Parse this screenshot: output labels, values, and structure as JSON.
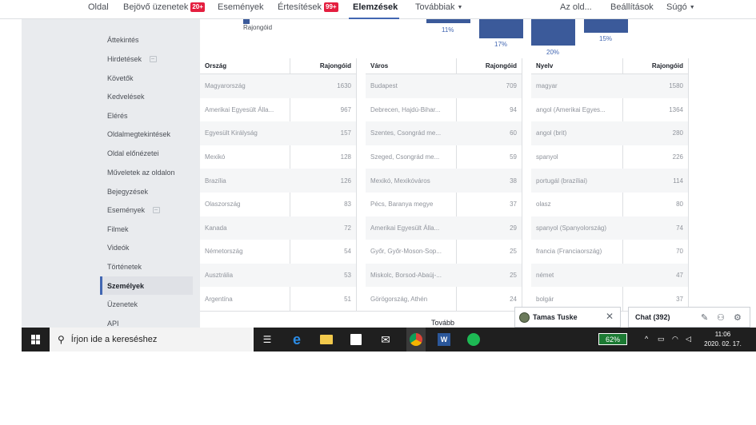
{
  "topnav": {
    "items": [
      {
        "label": "Oldal"
      },
      {
        "label": "Bejövő üzenetek",
        "badge": "20+"
      },
      {
        "label": "Események"
      },
      {
        "label": "Értesítések",
        "badge": "99+"
      },
      {
        "label": "Elemzések"
      },
      {
        "label": "Továbbiak"
      }
    ],
    "right": [
      "Az old...",
      "Beállítások",
      "Súgó"
    ]
  },
  "chart_remnant": {
    "legend_label": "Rajongóid",
    "bars": [
      {
        "label": "11%",
        "value": 11
      },
      {
        "label": "17%",
        "value": 17
      },
      {
        "label": "20%",
        "value": 20
      },
      {
        "label": "15%",
        "value": 15
      }
    ]
  },
  "sidebar": {
    "items": [
      {
        "label": "Áttekintés"
      },
      {
        "label": "Hirdetések"
      },
      {
        "label": "Követők"
      },
      {
        "label": "Kedvelések"
      },
      {
        "label": "Elérés"
      },
      {
        "label": "Oldalmegtekintések"
      },
      {
        "label": "Oldal előnézetei"
      },
      {
        "label": "Műveletek az oldalon"
      },
      {
        "label": "Bejegyzések"
      },
      {
        "label": "Események"
      },
      {
        "label": "Filmek"
      },
      {
        "label": "Videók"
      },
      {
        "label": "Történetek"
      },
      {
        "label": "Személyek"
      },
      {
        "label": "Üzenetek"
      },
      {
        "label": "API"
      }
    ]
  },
  "tables": [
    {
      "col1": "Ország",
      "col2": "Rajongóid",
      "rows": [
        [
          "Magyarország",
          "1630"
        ],
        [
          "Amerikai Egyesült Álla...",
          "967"
        ],
        [
          "Egyesült Királyság",
          "157"
        ],
        [
          "Mexikó",
          "128"
        ],
        [
          "Brazília",
          "126"
        ],
        [
          "Olaszország",
          "83"
        ],
        [
          "Kanada",
          "72"
        ],
        [
          "Németország",
          "54"
        ],
        [
          "Ausztrália",
          "53"
        ],
        [
          "Argentína",
          "51"
        ]
      ]
    },
    {
      "col1": "Város",
      "col2": "Rajongóid",
      "rows": [
        [
          "Budapest",
          "709"
        ],
        [
          "Debrecen, Hajdú-Bihar...",
          "94"
        ],
        [
          "Szentes, Csongrád me...",
          "60"
        ],
        [
          "Szeged, Csongrád me...",
          "59"
        ],
        [
          "Mexikó, Mexikóváros",
          "38"
        ],
        [
          "Pécs, Baranya megye",
          "37"
        ],
        [
          "Amerikai Egyesült Álla...",
          "29"
        ],
        [
          "Győr, Győr-Moson-Sop...",
          "25"
        ],
        [
          "Miskolc, Borsod-Abaúj-...",
          "25"
        ],
        [
          "Görögország, Athén",
          "24"
        ]
      ]
    },
    {
      "col1": "Nyelv",
      "col2": "Rajongóid",
      "rows": [
        [
          "magyar",
          "1580"
        ],
        [
          "angol (Amerikai Egyes...",
          "1364"
        ],
        [
          "angol (brit)",
          "280"
        ],
        [
          "spanyol",
          "226"
        ],
        [
          "portugál (brazíliai)",
          "114"
        ],
        [
          "olasz",
          "80"
        ],
        [
          "spanyol (Spanyolország)",
          "74"
        ],
        [
          "francia (Franciaország)",
          "70"
        ],
        [
          "német",
          "47"
        ],
        [
          "bolgár",
          "37"
        ]
      ]
    }
  ],
  "more_label": "Tovább",
  "chat": {
    "contact": "Tamas Tuske",
    "main_label": "Chat (392)"
  },
  "taskbar": {
    "search_placeholder": "Írjon ide a kereséshez",
    "battery": "62%",
    "time": "11:06",
    "date": "2020. 02. 17."
  }
}
